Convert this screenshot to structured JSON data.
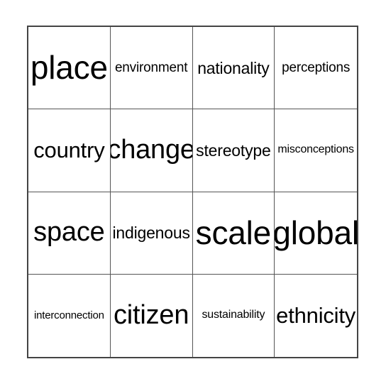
{
  "card": {
    "type": "bingo-card",
    "rows": 4,
    "columns": 4,
    "background_color": "#ffffff",
    "border_color": "#444444",
    "grid_line_color": "#555555",
    "text_color": "#000000",
    "cells": [
      {
        "text": "place",
        "size": "size-xl"
      },
      {
        "text": "environment",
        "size": "size-xs"
      },
      {
        "text": "nationality",
        "size": "size-sm"
      },
      {
        "text": "perceptions",
        "size": "size-xs"
      },
      {
        "text": "country",
        "size": "size-md"
      },
      {
        "text": "change",
        "size": "size-lg"
      },
      {
        "text": "stereotype",
        "size": "size-sm"
      },
      {
        "text": "misconceptions",
        "size": "size-xxs"
      },
      {
        "text": "space",
        "size": "size-lg"
      },
      {
        "text": "indigenous",
        "size": "size-sm"
      },
      {
        "text": "scale",
        "size": "size-xl"
      },
      {
        "text": "global",
        "size": "size-xl"
      },
      {
        "text": "interconnection",
        "size": "size-xxxs"
      },
      {
        "text": "citizen",
        "size": "size-lg"
      },
      {
        "text": "sustainability",
        "size": "size-xxs"
      },
      {
        "text": "ethnicity",
        "size": "size-md"
      }
    ]
  }
}
